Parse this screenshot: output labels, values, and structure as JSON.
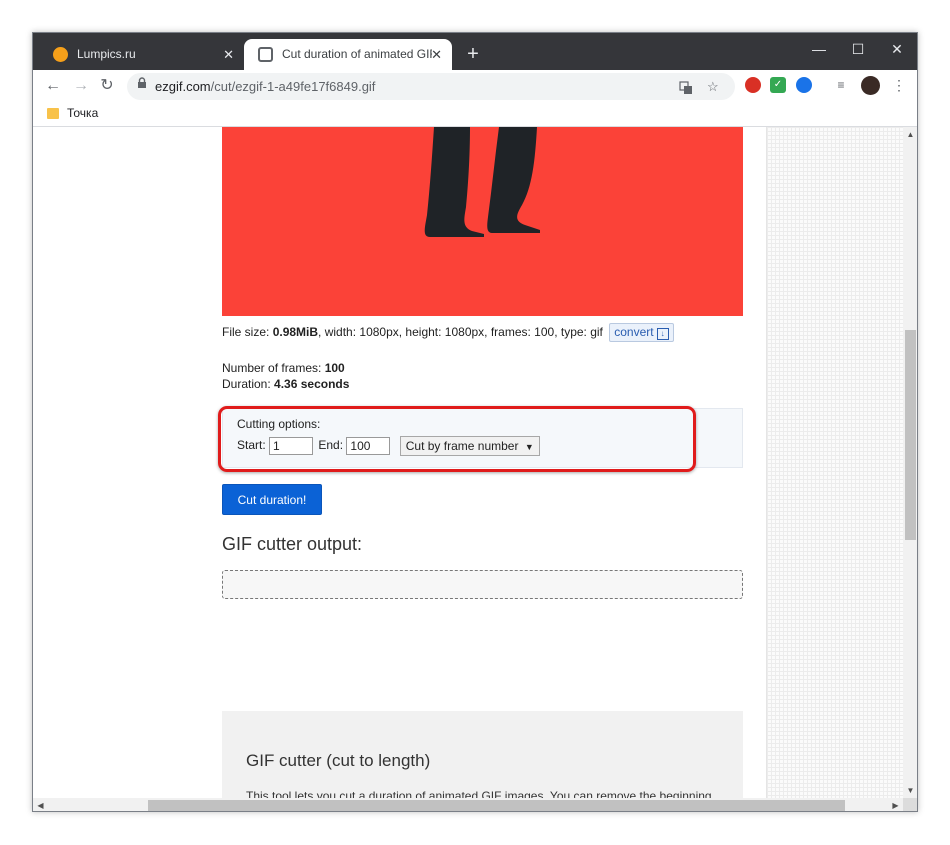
{
  "browser": {
    "tabs": [
      {
        "title": "Lumpics.ru",
        "active": false
      },
      {
        "title": "Cut duration of animated GIF - ezgif",
        "active": true
      }
    ],
    "close_glyph": "✕",
    "new_tab_glyph": "+",
    "window_controls": {
      "minimize": "—",
      "maximize": "☐",
      "close": "✕"
    },
    "nav": {
      "back": "←",
      "forward": "→",
      "reload": "↻"
    },
    "url_host": "ezgif.com",
    "url_path": "/cut/ezgif-1-a49fe17f6849.gif",
    "bookmarks": [
      {
        "label": "Точка"
      }
    ]
  },
  "page": {
    "fileinfo": {
      "file_size_label": "File size: ",
      "file_size": "0.98MiB",
      "rest": ", width: 1080px, height: 1080px, frames: 100, type: gif",
      "convert_label": "convert"
    },
    "frames": {
      "count_label": "Number of frames: ",
      "count": "100",
      "duration_label": "Duration: ",
      "duration": "4.36 seconds"
    },
    "cutting": {
      "title": "Cutting options:",
      "start_label": "Start:",
      "start_value": "1",
      "end_label": "End:",
      "end_value": "100",
      "mode": "Cut by frame number"
    },
    "cut_button": "Cut duration!",
    "output_title": "GIF cutter output:",
    "info_title": "GIF cutter (cut to length)",
    "info_text": "This tool lets you cut a duration of animated GIF images. You can remove the beginning"
  },
  "colors": {
    "gif_background": "#fb4238",
    "highlight": "#e01b1b",
    "button": "#0b62d6"
  }
}
